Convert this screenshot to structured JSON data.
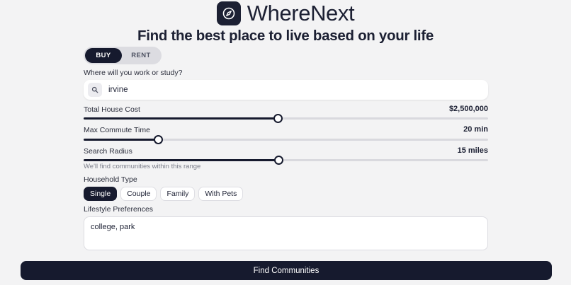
{
  "brand": {
    "name": "WhereNext",
    "icon": "compass-icon"
  },
  "headline": "Find the best place to live based on your life",
  "mode_toggle": {
    "options": [
      "BUY",
      "RENT"
    ],
    "selected": "BUY"
  },
  "work_location": {
    "label": "Where will you work or study?",
    "value": "irvine",
    "icon": "search-icon"
  },
  "house_cost": {
    "label": "Total House Cost",
    "value_text": "$2,500,000",
    "fraction": 0.479
  },
  "commute": {
    "label": "Max Commute Time",
    "value_text": "20 min",
    "fraction": 0.184
  },
  "radius": {
    "label": "Search Radius",
    "value_text": "15 miles",
    "fraction": 0.482,
    "hint": "We'll find communities within this range"
  },
  "household": {
    "label": "Household Type",
    "options": [
      "Single",
      "Couple",
      "Family",
      "With Pets"
    ],
    "selected": "Single"
  },
  "lifestyle": {
    "label": "Lifestyle Preferences",
    "value": "college, park"
  },
  "cta": {
    "label": "Find Communities"
  },
  "colors": {
    "primary": "#161a2e",
    "background": "#f3f3f4",
    "track": "#d9d9de"
  }
}
